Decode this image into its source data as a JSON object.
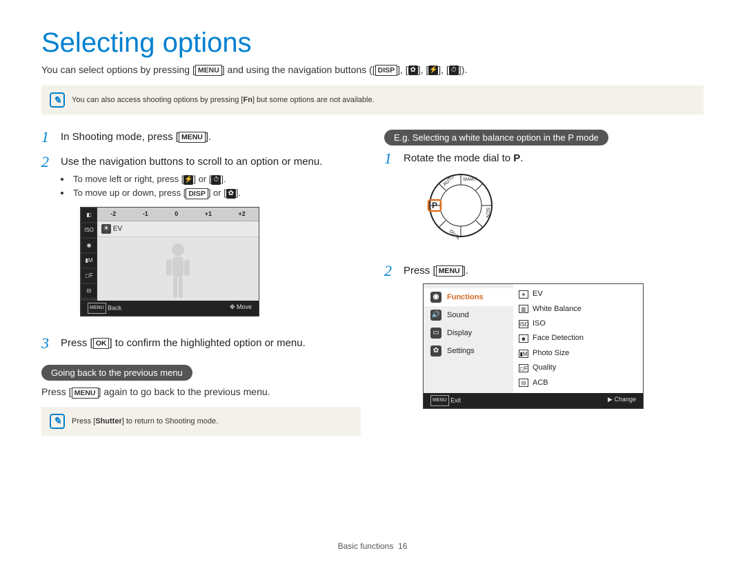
{
  "title": "Selecting options",
  "intro_pre": "You can select options by pressing [",
  "intro_menu": "MENU",
  "intro_mid": "] and using the navigation buttons ([",
  "intro_disp": "DISP",
  "intro_post": "]).",
  "note1_pre": "You can also access shooting options by pressing [",
  "note1_fn": "Fn",
  "note1_post": "] but some options are not available.",
  "left": {
    "step1_pre": "In Shooting mode, press [",
    "step1_btn": "MENU",
    "step1_post": "].",
    "step2": "Use the navigation buttons to scroll to an option or menu.",
    "sub_lr": "To move left or right, press [",
    "sub_lr_mid": "] or [",
    "sub_lr_end": "].",
    "sub_ud": "To move up or down, press [",
    "sub_ud_disp": "DISP",
    "sub_ud_mid": "] or [",
    "sub_ud_end": "].",
    "step3_pre": "Press [",
    "step3_btn": "OK",
    "step3_post": "] to confirm the highlighted option or menu.",
    "pill": "Going back to the previous menu",
    "back_pre": "Press [",
    "back_btn": "MENU",
    "back_post": "] again to go back to the previous menu.",
    "note2_pre": "Press [",
    "note2_btn": "Shutter",
    "note2_post": "] to return to Shooting mode.",
    "lcd": {
      "scale": [
        "-2",
        "-1",
        "0",
        "+1",
        "+2"
      ],
      "ev": "EV",
      "footer_back": "Back",
      "footer_back_btn": "MENU",
      "footer_move": "Move"
    }
  },
  "right": {
    "pill": "E.g. Selecting a white balance option in the P mode",
    "step1_pre": "Rotate the mode dial to ",
    "step1_btn": "P",
    "step1_post": ".",
    "step2_pre": "Press [",
    "step2_btn": "MENU",
    "step2_post": "].",
    "menu_left": {
      "functions": "Functions",
      "sound": "Sound",
      "display": "Display",
      "settings": "Settings"
    },
    "menu_right": {
      "ev": "EV",
      "wb": "White Balance",
      "iso": "ISO",
      "face": "Face Detection",
      "photo": "Photo Size",
      "quality": "Quality",
      "acb": "ACB"
    },
    "lcd_footer_exit": "Exit",
    "lcd_footer_exit_btn": "MENU",
    "lcd_footer_change": "Change"
  },
  "footer_section": "Basic functions",
  "footer_page": "16"
}
